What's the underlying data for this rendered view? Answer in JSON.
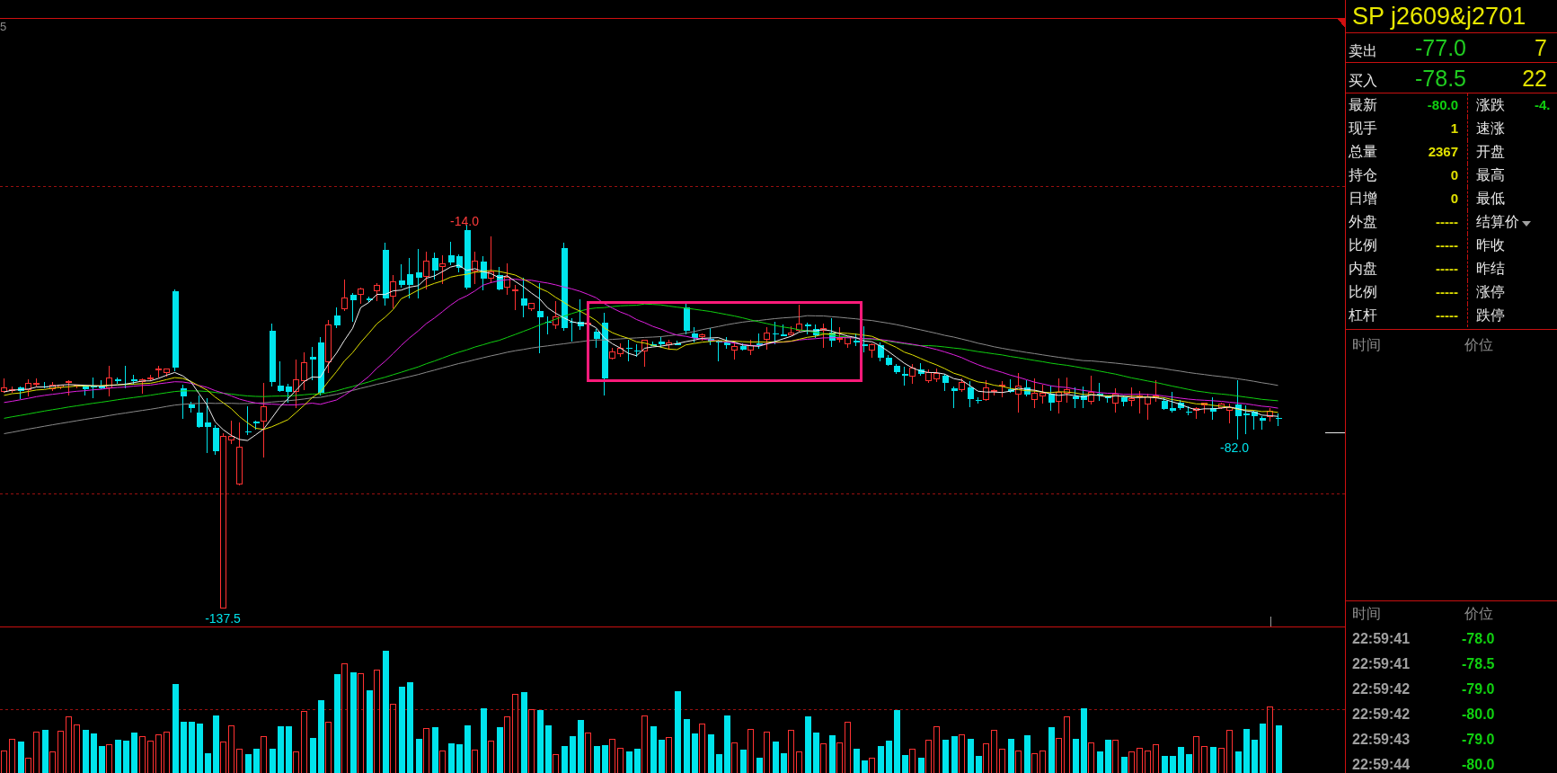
{
  "chart": {
    "axis_label": "5",
    "high_label": "-14.0",
    "low_label": "-137.5",
    "recent_low_label": "-82.0"
  },
  "quote_panel": {
    "title": "SP j2609&j2701",
    "ask": {
      "label": "卖出",
      "price": "-77.0",
      "volume": "7"
    },
    "bid": {
      "label": "买入",
      "price": "-78.5",
      "volume": "22"
    },
    "stats": [
      [
        {
          "label": "最新",
          "value": "-80.0",
          "color": "#10d010"
        },
        {
          "label": "涨跌",
          "value": "-4.",
          "color": "#10d010",
          "dropdown": false
        }
      ],
      [
        {
          "label": "现手",
          "value": "1",
          "color": "#e0e000"
        },
        {
          "label": "速涨",
          "dropdown": false
        }
      ],
      [
        {
          "label": "总量",
          "value": "2367",
          "color": "#e0e000"
        },
        {
          "label": "开盘",
          "dropdown": false
        }
      ],
      [
        {
          "label": "持仓",
          "value": "0",
          "color": "#e0e000"
        },
        {
          "label": "最高",
          "dropdown": false
        }
      ],
      [
        {
          "label": "日增",
          "value": "0",
          "color": "#e0e000"
        },
        {
          "label": "最低",
          "dropdown": false
        }
      ],
      [
        {
          "label": "外盘",
          "value": "-----",
          "color": "#e0e000"
        },
        {
          "label": "结算价",
          "dropdown": true
        }
      ],
      [
        {
          "label": "比例",
          "value": "-----",
          "color": "#e0e000"
        },
        {
          "label": "昨收",
          "dropdown": false
        }
      ],
      [
        {
          "label": "内盘",
          "value": "-----",
          "color": "#e0e000"
        },
        {
          "label": "昨结",
          "dropdown": false
        }
      ],
      [
        {
          "label": "比例",
          "value": "-----",
          "color": "#e0e000"
        },
        {
          "label": "涨停",
          "dropdown": false
        }
      ],
      [
        {
          "label": "杠杆",
          "value": "-----",
          "color": "#e0e000"
        },
        {
          "label": "跌停",
          "dropdown": false
        }
      ]
    ]
  },
  "tick_chart": {
    "columns": [
      "时间",
      "价位"
    ]
  },
  "trades": {
    "columns": [
      "时间",
      "价位"
    ],
    "rows": [
      {
        "time": "22:59:41",
        "price": "-78.0"
      },
      {
        "time": "22:59:41",
        "price": "-78.5"
      },
      {
        "time": "22:59:42",
        "price": "-79.0"
      },
      {
        "time": "22:59:42",
        "price": "-80.0"
      },
      {
        "time": "22:59:43",
        "price": "-79.0"
      },
      {
        "time": "22:59:44",
        "price": "-80.0"
      }
    ]
  }
}
